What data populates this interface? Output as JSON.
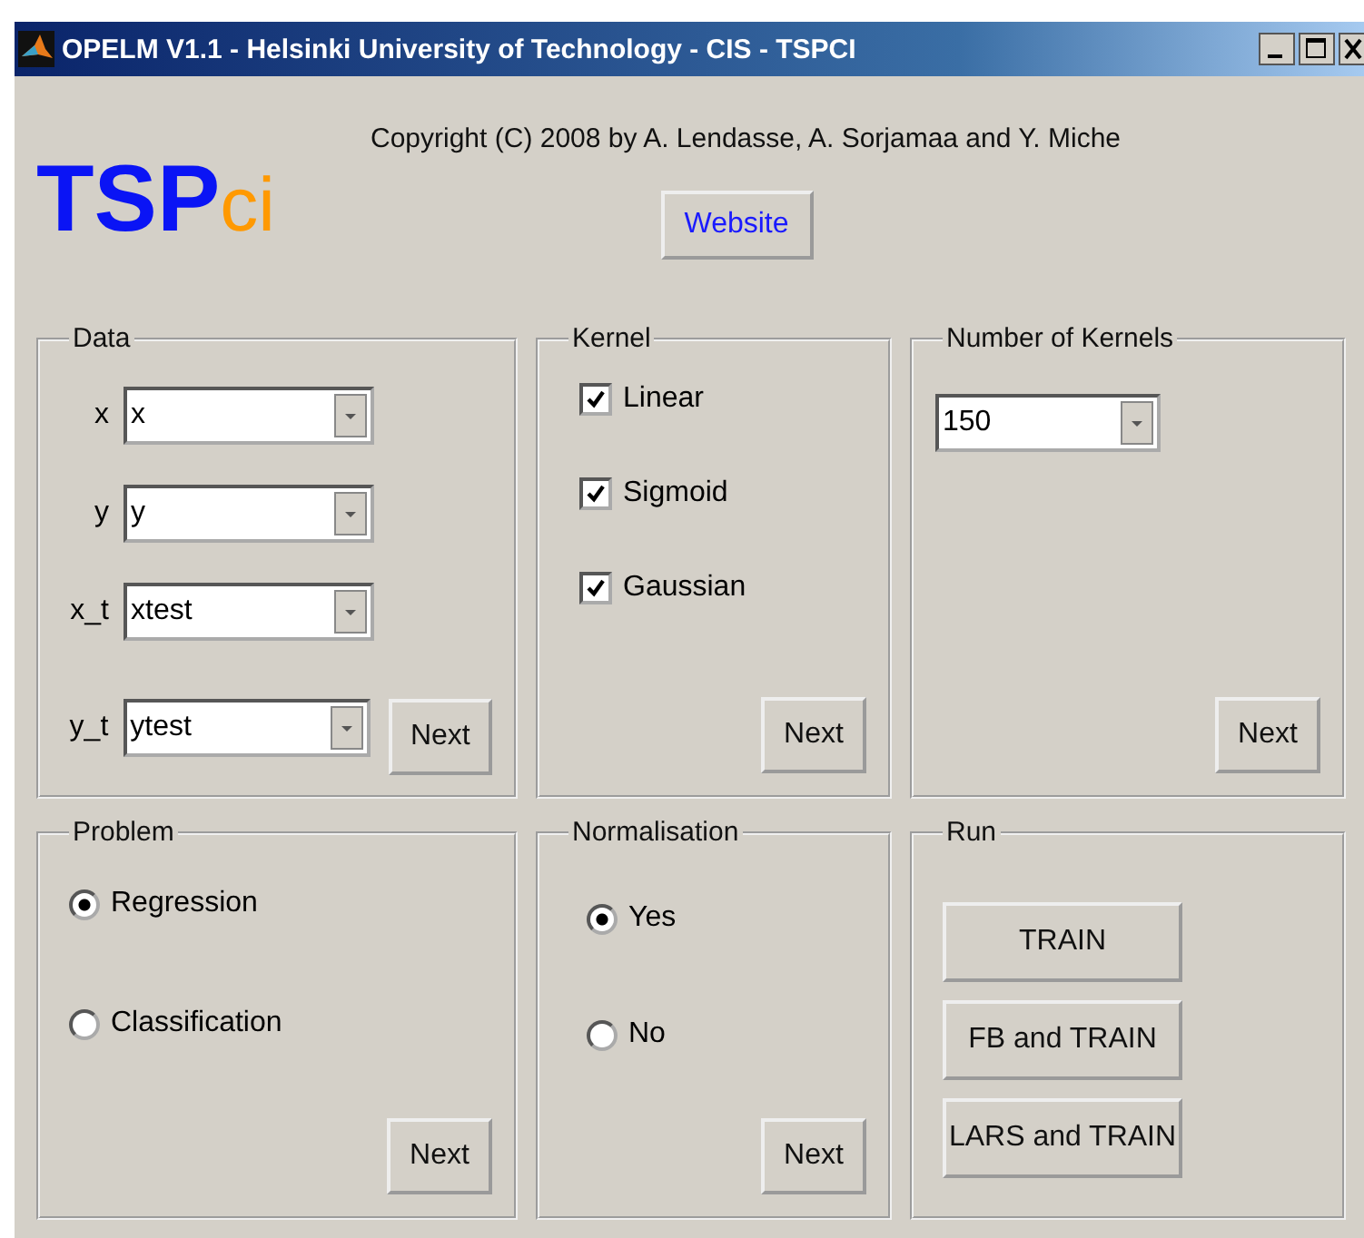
{
  "window": {
    "title": "OPELM V1.1 - Helsinki University of Technology - CIS - TSPCI"
  },
  "logo": {
    "main": "TSP",
    "suffix": "ci"
  },
  "copyright": "Copyright (C) 2008 by A. Lendasse, A. Sorjamaa and Y. Miche",
  "website_button": "Website",
  "data": {
    "title": "Data",
    "fields": [
      {
        "label": "x",
        "value": "x"
      },
      {
        "label": "y",
        "value": "y"
      },
      {
        "label": "x_t",
        "value": "xtest"
      },
      {
        "label": "y_t",
        "value": "ytest"
      }
    ],
    "next": "Next"
  },
  "kernel": {
    "title": "Kernel",
    "options": [
      {
        "label": "Linear",
        "checked": true
      },
      {
        "label": "Sigmoid",
        "checked": true
      },
      {
        "label": "Gaussian",
        "checked": true
      }
    ],
    "next": "Next"
  },
  "number_of_kernels": {
    "title": "Number of Kernels",
    "value": "150",
    "next": "Next"
  },
  "problem": {
    "title": "Problem",
    "options": [
      {
        "label": "Regression",
        "selected": true
      },
      {
        "label": "Classification",
        "selected": false
      }
    ],
    "next": "Next"
  },
  "normalisation": {
    "title": "Normalisation",
    "options": [
      {
        "label": "Yes",
        "selected": true
      },
      {
        "label": "No",
        "selected": false
      }
    ],
    "next": "Next"
  },
  "run": {
    "title": "Run",
    "buttons": [
      "TRAIN",
      "FB and TRAIN",
      "LARS and TRAIN"
    ]
  }
}
